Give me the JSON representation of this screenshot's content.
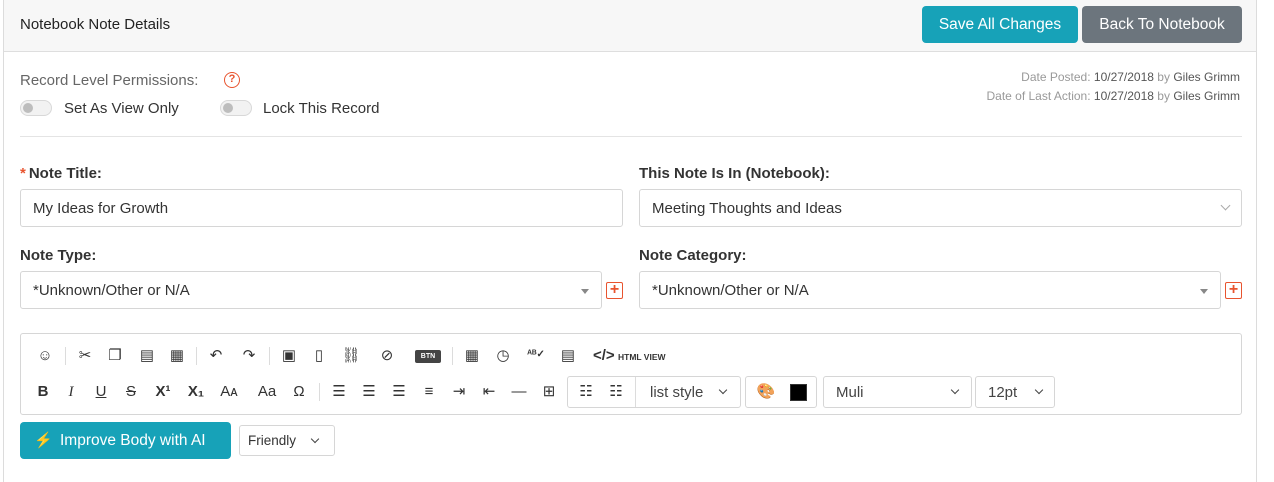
{
  "header": {
    "title": "Notebook Note Details",
    "save_label": "Save All Changes",
    "back_label": "Back To Notebook"
  },
  "permissions": {
    "label": "Record Level Permissions:",
    "help": "?",
    "view_only_label": "Set As View Only",
    "view_only_on": false,
    "lock_label": "Lock This Record",
    "lock_on": false
  },
  "meta": {
    "posted_label": "Date Posted:",
    "posted_date": "10/27/2018",
    "by": "by",
    "posted_by": "Giles Grimm",
    "last_action_label": "Date of Last Action:",
    "last_action_date": "10/27/2018",
    "last_action_by": "Giles Grimm"
  },
  "form": {
    "title_label": "Note Title:",
    "title_required": "*",
    "title_value": "My Ideas for Growth",
    "notebook_label": "This Note Is In (Notebook):",
    "notebook_value": "Meeting Thoughts and Ideas",
    "type_label": "Note Type:",
    "type_value": "*Unknown/Other or N/A",
    "category_label": "Note Category:",
    "category_value": "*Unknown/Other or N/A",
    "add_symbol": "+"
  },
  "toolbar": {
    "html_view_label": "HTML VIEW",
    "btn_label": "BTN",
    "list_style_label": "list style",
    "font_family_value": "Muli",
    "font_size_value": "12pt",
    "text_color": "#000000"
  },
  "ai": {
    "improve_label": "Improve Body with AI",
    "tone_value": "Friendly"
  },
  "colors": {
    "accent": "#17a2b8",
    "secondary": "#6c757d",
    "required": "#e8542f"
  }
}
